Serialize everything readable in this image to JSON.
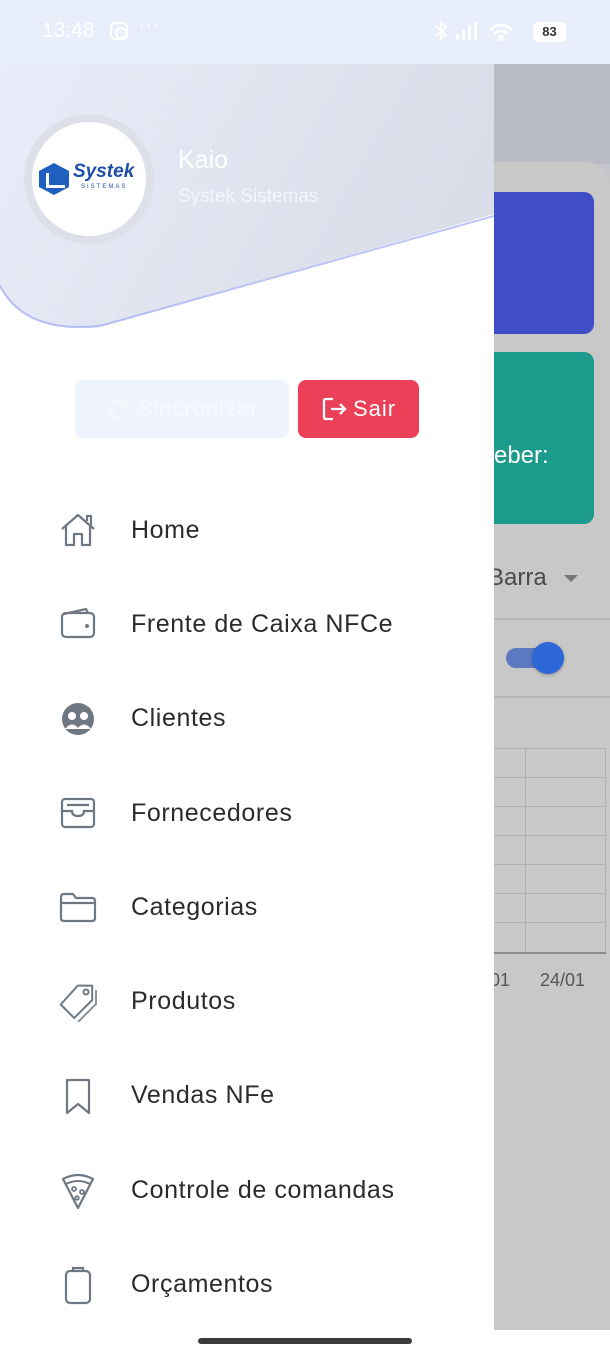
{
  "status_bar": {
    "time": "13:48",
    "dots": "···",
    "battery": "83",
    "icons": [
      "instagram-icon",
      "bluetooth-icon",
      "signal-icon",
      "wifi-icon",
      "battery-icon"
    ]
  },
  "drawer": {
    "user_name": "Kaio",
    "company": "Systek Sistemas",
    "logo_text": "Systek",
    "logo_subtext": "SISTEMAS",
    "sync_label": "Sincronizar",
    "logout_label": "Sair",
    "menu": [
      {
        "label": "Home",
        "icon": "home-icon"
      },
      {
        "label": "Frente de Caixa NFCe",
        "icon": "wallet-icon"
      },
      {
        "label": "Clientes",
        "icon": "users-icon"
      },
      {
        "label": "Fornecedores",
        "icon": "inbox-icon"
      },
      {
        "label": "Categorias",
        "icon": "folder-icon"
      },
      {
        "label": "Produtos",
        "icon": "tags-icon"
      },
      {
        "label": "Vendas NFe",
        "icon": "bookmark-icon"
      },
      {
        "label": "Controle de comandas",
        "icon": "pizza-icon"
      },
      {
        "label": "Orçamentos",
        "icon": "clipboard-icon"
      }
    ]
  },
  "background": {
    "card_text": "eber:",
    "select_text": "Barra",
    "toggle_on": true,
    "x_labels": [
      "01",
      "24/01"
    ]
  },
  "colors": {
    "logout": "#ec4058",
    "sync": "#eef3fd",
    "card_blue": "#3f4dc6",
    "card_green": "#1c9b8c",
    "toggle": "#2e68d8"
  }
}
